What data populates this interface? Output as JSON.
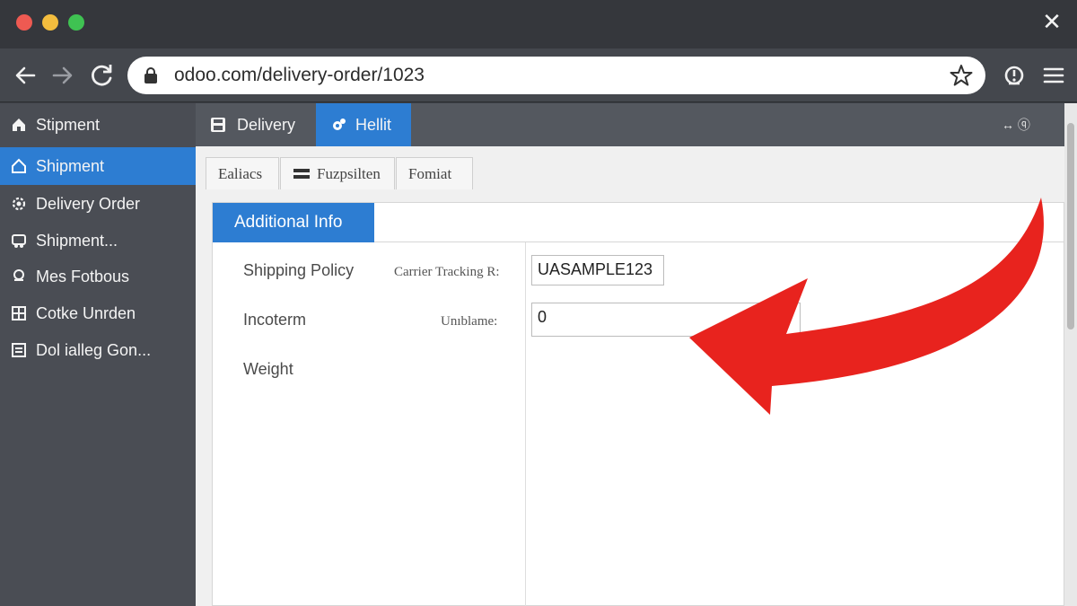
{
  "browser": {
    "url": "odoo.com/delivery-order/1023",
    "close_glyph": "✕"
  },
  "sidebar": {
    "items": [
      {
        "label": "Stipment",
        "icon": "home-icon"
      },
      {
        "label": "Shipment",
        "icon": "home-icon",
        "active": true
      },
      {
        "label": "Delivery Order",
        "icon": "gear-icon"
      },
      {
        "label": "Shipment...",
        "icon": "truck-icon"
      },
      {
        "label": "Mes Fotbous",
        "icon": "pin-icon"
      },
      {
        "label": "Cotke Unrden",
        "icon": "grid-icon"
      },
      {
        "label": "Dol ialleg Gon...",
        "icon": "list-icon"
      }
    ]
  },
  "topbar": {
    "tabs": [
      {
        "label": "Delivery",
        "icon": "save-icon"
      },
      {
        "label": "Hellit",
        "icon": "settings-icon",
        "active": true
      }
    ],
    "right_text": "↔ ⓠ"
  },
  "subtabs": [
    {
      "label": "Ealiacs"
    },
    {
      "label": "Fuzpsilten",
      "icon": "menu-icon"
    },
    {
      "label": "Fomiat"
    }
  ],
  "form": {
    "active_tab": "Additional Info",
    "shipping_policy_label": "Shipping Policy",
    "carrier_tracking_label": "Carrier Tracking R:",
    "carrier_tracking_value": "UASAMPLE123",
    "incoterm_label": "Incoterm",
    "unblame_label": "Unıblame:",
    "unblame_value": "0",
    "weight_label": "Weight"
  },
  "colors": {
    "accent": "#2d7dd2",
    "annotation_arrow": "#e8231e"
  }
}
